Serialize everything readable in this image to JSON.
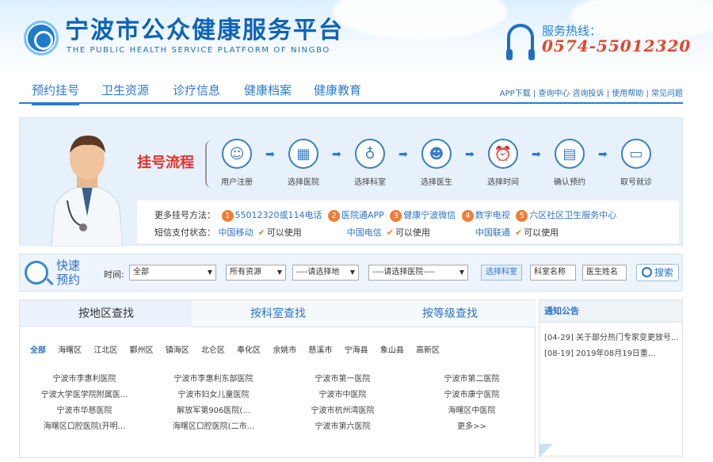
{
  "header": {
    "title_cn": "宁波市公众健康服务平台",
    "title_en": "THE PUBLIC HEALTH SERVICE PLATFORM OF NINGBO",
    "hotline_label": "服务热线：",
    "hotline_number": "0574-55012320"
  },
  "nav": {
    "items": [
      "预约挂号",
      "卫生资源",
      "诊疗信息",
      "健康档案",
      "健康教育"
    ],
    "right_links": "APP下载 | 查询中心  咨询投诉 | 使用帮助 | 常见问题"
  },
  "flow": {
    "label": "挂号流程",
    "steps": [
      "用户注册",
      "选择医院",
      "选择科室",
      "选择医生",
      "选择时间",
      "确认预约",
      "取号就诊"
    ],
    "step_icons": [
      "user-icon",
      "hospital-icon",
      "stethoscope-icon",
      "doctor-icon",
      "alarm-clock-icon",
      "confirm-icon",
      "card-icon"
    ],
    "more_label": "更多挂号方法：",
    "methods": [
      {
        "num": "1",
        "text": "55012320或114电话"
      },
      {
        "num": "2",
        "text": "医院通APP"
      },
      {
        "num": "3",
        "text": "健康宁波微信"
      },
      {
        "num": "4",
        "text": "数字电视"
      },
      {
        "num": "5",
        "text": "六区社区卫生服务中心"
      }
    ],
    "sms_label": "短信支付状态：",
    "sms": [
      {
        "carrier": "中国移动",
        "status": "可以使用"
      },
      {
        "carrier": "中国电信",
        "status": "可以使用"
      },
      {
        "carrier": "中国联通",
        "status": "可以使用"
      }
    ]
  },
  "quick": {
    "title": "快速预约",
    "time_label": "时间:",
    "time_value": "全部",
    "resource_value": "所有资源",
    "area_placeholder": "----请选择地",
    "hospital_placeholder": "----请选择医院----",
    "dept_button": "选择科室",
    "dept_input": "科室名称",
    "doctor_input": "医生姓名",
    "search_button": "搜索"
  },
  "hospital_tabs": [
    "按地区查找",
    "按科室查找",
    "按等级查找"
  ],
  "districts": [
    "全部",
    "海曙区",
    "江北区",
    "鄞州区",
    "镇海区",
    "北仑区",
    "奉化区",
    "余姚市",
    "慈溪市",
    "宁海县",
    "象山县",
    "高新区"
  ],
  "hospitals": [
    "宁波市李惠利医院",
    "宁波市李惠利东部医院",
    "宁波市第一医院",
    "宁波市第二医院",
    "宁波大学医学院附属医...",
    "宁波市妇女儿童医院",
    "宁波市中医院",
    "宁波市康宁医院",
    "宁波市华慈医院",
    "解放军第906医院(...",
    "宁波市杭州湾医院",
    "海曙区中医院",
    "海曙区口腔医院(开明...",
    "海曙区口腔医院(二市...",
    "宁波市第六医院",
    "更多>>"
  ],
  "notice": {
    "title": "通知公告",
    "items": [
      "[04-29]  关于部分热门专家变更放号...",
      "[08-19]  2019年08月19日重..."
    ]
  },
  "colors": {
    "brand_blue": "#2a7ad1",
    "accent_orange": "#f07c35",
    "title_red": "#e0332b"
  }
}
